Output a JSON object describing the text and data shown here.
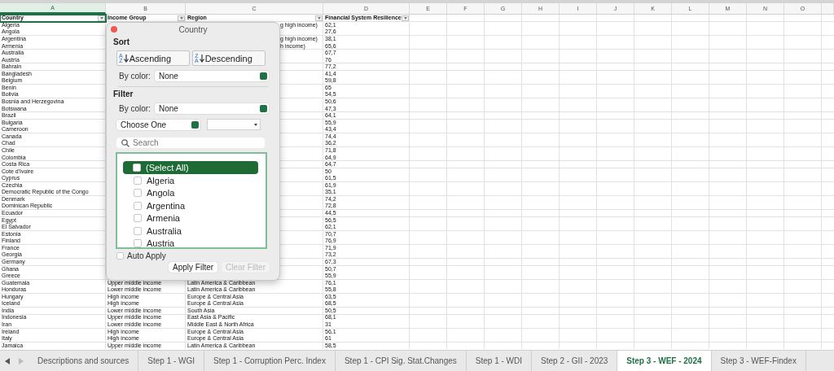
{
  "column_headers": [
    {
      "label": "A",
      "selected": true
    },
    {
      "label": "B",
      "selected": false
    },
    {
      "label": "C",
      "selected": false
    },
    {
      "label": "D",
      "selected": false
    },
    {
      "label": "E",
      "selected": false
    },
    {
      "label": "F",
      "selected": false
    },
    {
      "label": "G",
      "selected": false
    },
    {
      "label": "H",
      "selected": false
    },
    {
      "label": "I",
      "selected": false
    },
    {
      "label": "J",
      "selected": false
    },
    {
      "label": "K",
      "selected": false
    },
    {
      "label": "L",
      "selected": false
    },
    {
      "label": "M",
      "selected": false
    },
    {
      "label": "N",
      "selected": false
    },
    {
      "label": "O",
      "selected": false
    }
  ],
  "table": {
    "columns": [
      {
        "label": "Country",
        "selected": true
      },
      {
        "label": "Income Group",
        "selected": false
      },
      {
        "label": "Region",
        "selected": false
      },
      {
        "label": "Financial System Resilience",
        "selected": false
      }
    ],
    "rows": [
      {
        "country": "Algeria",
        "region": "g high income)",
        "resilience": "62,1"
      },
      {
        "country": "Angola",
        "resilience": "27,6"
      },
      {
        "country": "Argentina",
        "region": "g high income)",
        "resilience": "38,1"
      },
      {
        "country": "Armenia",
        "region": "h income)",
        "resilience": "65,6"
      },
      {
        "country": "Australia",
        "resilience": "67,7"
      },
      {
        "country": "Austria",
        "resilience": "76"
      },
      {
        "country": "Bahrain",
        "resilience": "77,2"
      },
      {
        "country": "Bangladesh",
        "resilience": "41,4"
      },
      {
        "country": "Belgium",
        "resilience": "59,8"
      },
      {
        "country": "Benin",
        "resilience": "65"
      },
      {
        "country": "Bolivia",
        "resilience": "54,5"
      },
      {
        "country": "Bosnia and Herzegovina",
        "resilience": "50,6"
      },
      {
        "country": "Botswana",
        "resilience": "47,3"
      },
      {
        "country": "Brazil",
        "resilience": "64,1"
      },
      {
        "country": "Bulgaria",
        "resilience": "55,9"
      },
      {
        "country": "Cameroon",
        "resilience": "43,4"
      },
      {
        "country": "Canada",
        "resilience": "74,4"
      },
      {
        "country": "Chad",
        "resilience": "36,2"
      },
      {
        "country": "Chile",
        "resilience": "71,8"
      },
      {
        "country": "Colombia",
        "resilience": "64,9"
      },
      {
        "country": "Costa Rica",
        "resilience": "64,7"
      },
      {
        "country": "Cote d'Ivoire",
        "resilience": "50"
      },
      {
        "country": "Cyprus",
        "resilience": "61,5"
      },
      {
        "country": "Czechia",
        "resilience": "61,9"
      },
      {
        "country": "Democratic Republic of the Congo",
        "resilience": "35,1"
      },
      {
        "country": "Denmark",
        "resilience": "74,2"
      },
      {
        "country": "Dominican Republic",
        "resilience": "72,8"
      },
      {
        "country": "Ecuador",
        "resilience": "44,5"
      },
      {
        "country": "Egypt",
        "resilience": "56,5"
      },
      {
        "country": "El Salvador",
        "resilience": "62,1"
      },
      {
        "country": "Estonia",
        "resilience": "70,7"
      },
      {
        "country": "Finland",
        "resilience": "76,9"
      },
      {
        "country": "France",
        "resilience": "71,9"
      },
      {
        "country": "Georgia",
        "resilience": "73,2"
      },
      {
        "country": "Germany",
        "resilience": "67,3"
      },
      {
        "country": "Ghana",
        "resilience": "50,7"
      },
      {
        "country": "Greece",
        "resilience": "55,9"
      },
      {
        "country": "Guatemala",
        "income_group": "Upper middle income",
        "region": "Latin America & Caribbean",
        "resilience": "76,1"
      },
      {
        "country": "Honduras",
        "income_group": "Lower middle income",
        "region": "Latin America & Caribbean",
        "resilience": "55,8"
      },
      {
        "country": "Hungary",
        "income_group": "High income",
        "region": "Europe & Central Asia",
        "resilience": "63,5"
      },
      {
        "country": "Iceland",
        "income_group": "High income",
        "region": "Europe & Central Asia",
        "resilience": "68,5"
      },
      {
        "country": "India",
        "income_group": "Lower middle income",
        "region": "South Asia",
        "resilience": "50,5"
      },
      {
        "country": "Indonesia",
        "income_group": "Upper middle income",
        "region": "East Asia & Pacific",
        "resilience": "68,1"
      },
      {
        "country": "Iran",
        "income_group": "Lower middle income",
        "region": "Middle East & North Africa",
        "resilience": "31"
      },
      {
        "country": "Ireland",
        "income_group": "High income",
        "region": "Europe & Central Asia",
        "resilience": "56,1"
      },
      {
        "country": "Italy",
        "income_group": "High income",
        "region": "Europe & Central Asia",
        "resilience": "61"
      },
      {
        "country": "Jamaica",
        "income_group": "Upper middle income",
        "region": "Latin America & Caribbean",
        "resilience": "58,5"
      }
    ]
  },
  "filter_popup": {
    "title": "Country",
    "sort_label": "Sort",
    "sort_buttons": [
      {
        "label": "Ascending",
        "icon_letters": [
          "A",
          "Z"
        ]
      },
      {
        "label": "Descending",
        "icon_letters": [
          "Z",
          "A"
        ]
      }
    ],
    "sort_by_color": {
      "label": "By color:",
      "value": "None"
    },
    "filter_label": "Filter",
    "filter_by_color": {
      "label": "By color:",
      "value": "None"
    },
    "condition": {
      "value": "Choose One"
    },
    "search": {
      "placeholder": "Search"
    },
    "items": [
      {
        "label": "(Select All)",
        "checked": false,
        "selected": true
      },
      {
        "label": "Algeria",
        "checked": false,
        "selected": false
      },
      {
        "label": "Angola",
        "checked": false,
        "selected": false
      },
      {
        "label": "Argentina",
        "checked": false,
        "selected": false
      },
      {
        "label": "Armenia",
        "checked": false,
        "selected": false
      },
      {
        "label": "Australia",
        "checked": false,
        "selected": false
      },
      {
        "label": "Austria",
        "checked": false,
        "selected": false
      }
    ],
    "auto_apply": {
      "label": "Auto Apply",
      "checked": false
    },
    "buttons": [
      {
        "label": "Apply Filter",
        "disabled": false
      },
      {
        "label": "Clear Filter",
        "disabled": true
      }
    ]
  },
  "sheet_tabs": [
    {
      "label": "Descriptions and sources",
      "selected": false
    },
    {
      "label": "Step 1 - WGI",
      "selected": false
    },
    {
      "label": "Step 1 - Corruption Perc. Index",
      "selected": false
    },
    {
      "label": "Step 1 - CPI Sig. Stat.Changes",
      "selected": false
    },
    {
      "label": "Step 1 - WDI",
      "selected": false
    },
    {
      "label": "Step 2 - GII - 2023",
      "selected": false
    },
    {
      "label": "Step 3 - WEF - 2024",
      "selected": true
    },
    {
      "label": "Step 3 - WEF-Findex",
      "selected": false
    }
  ]
}
